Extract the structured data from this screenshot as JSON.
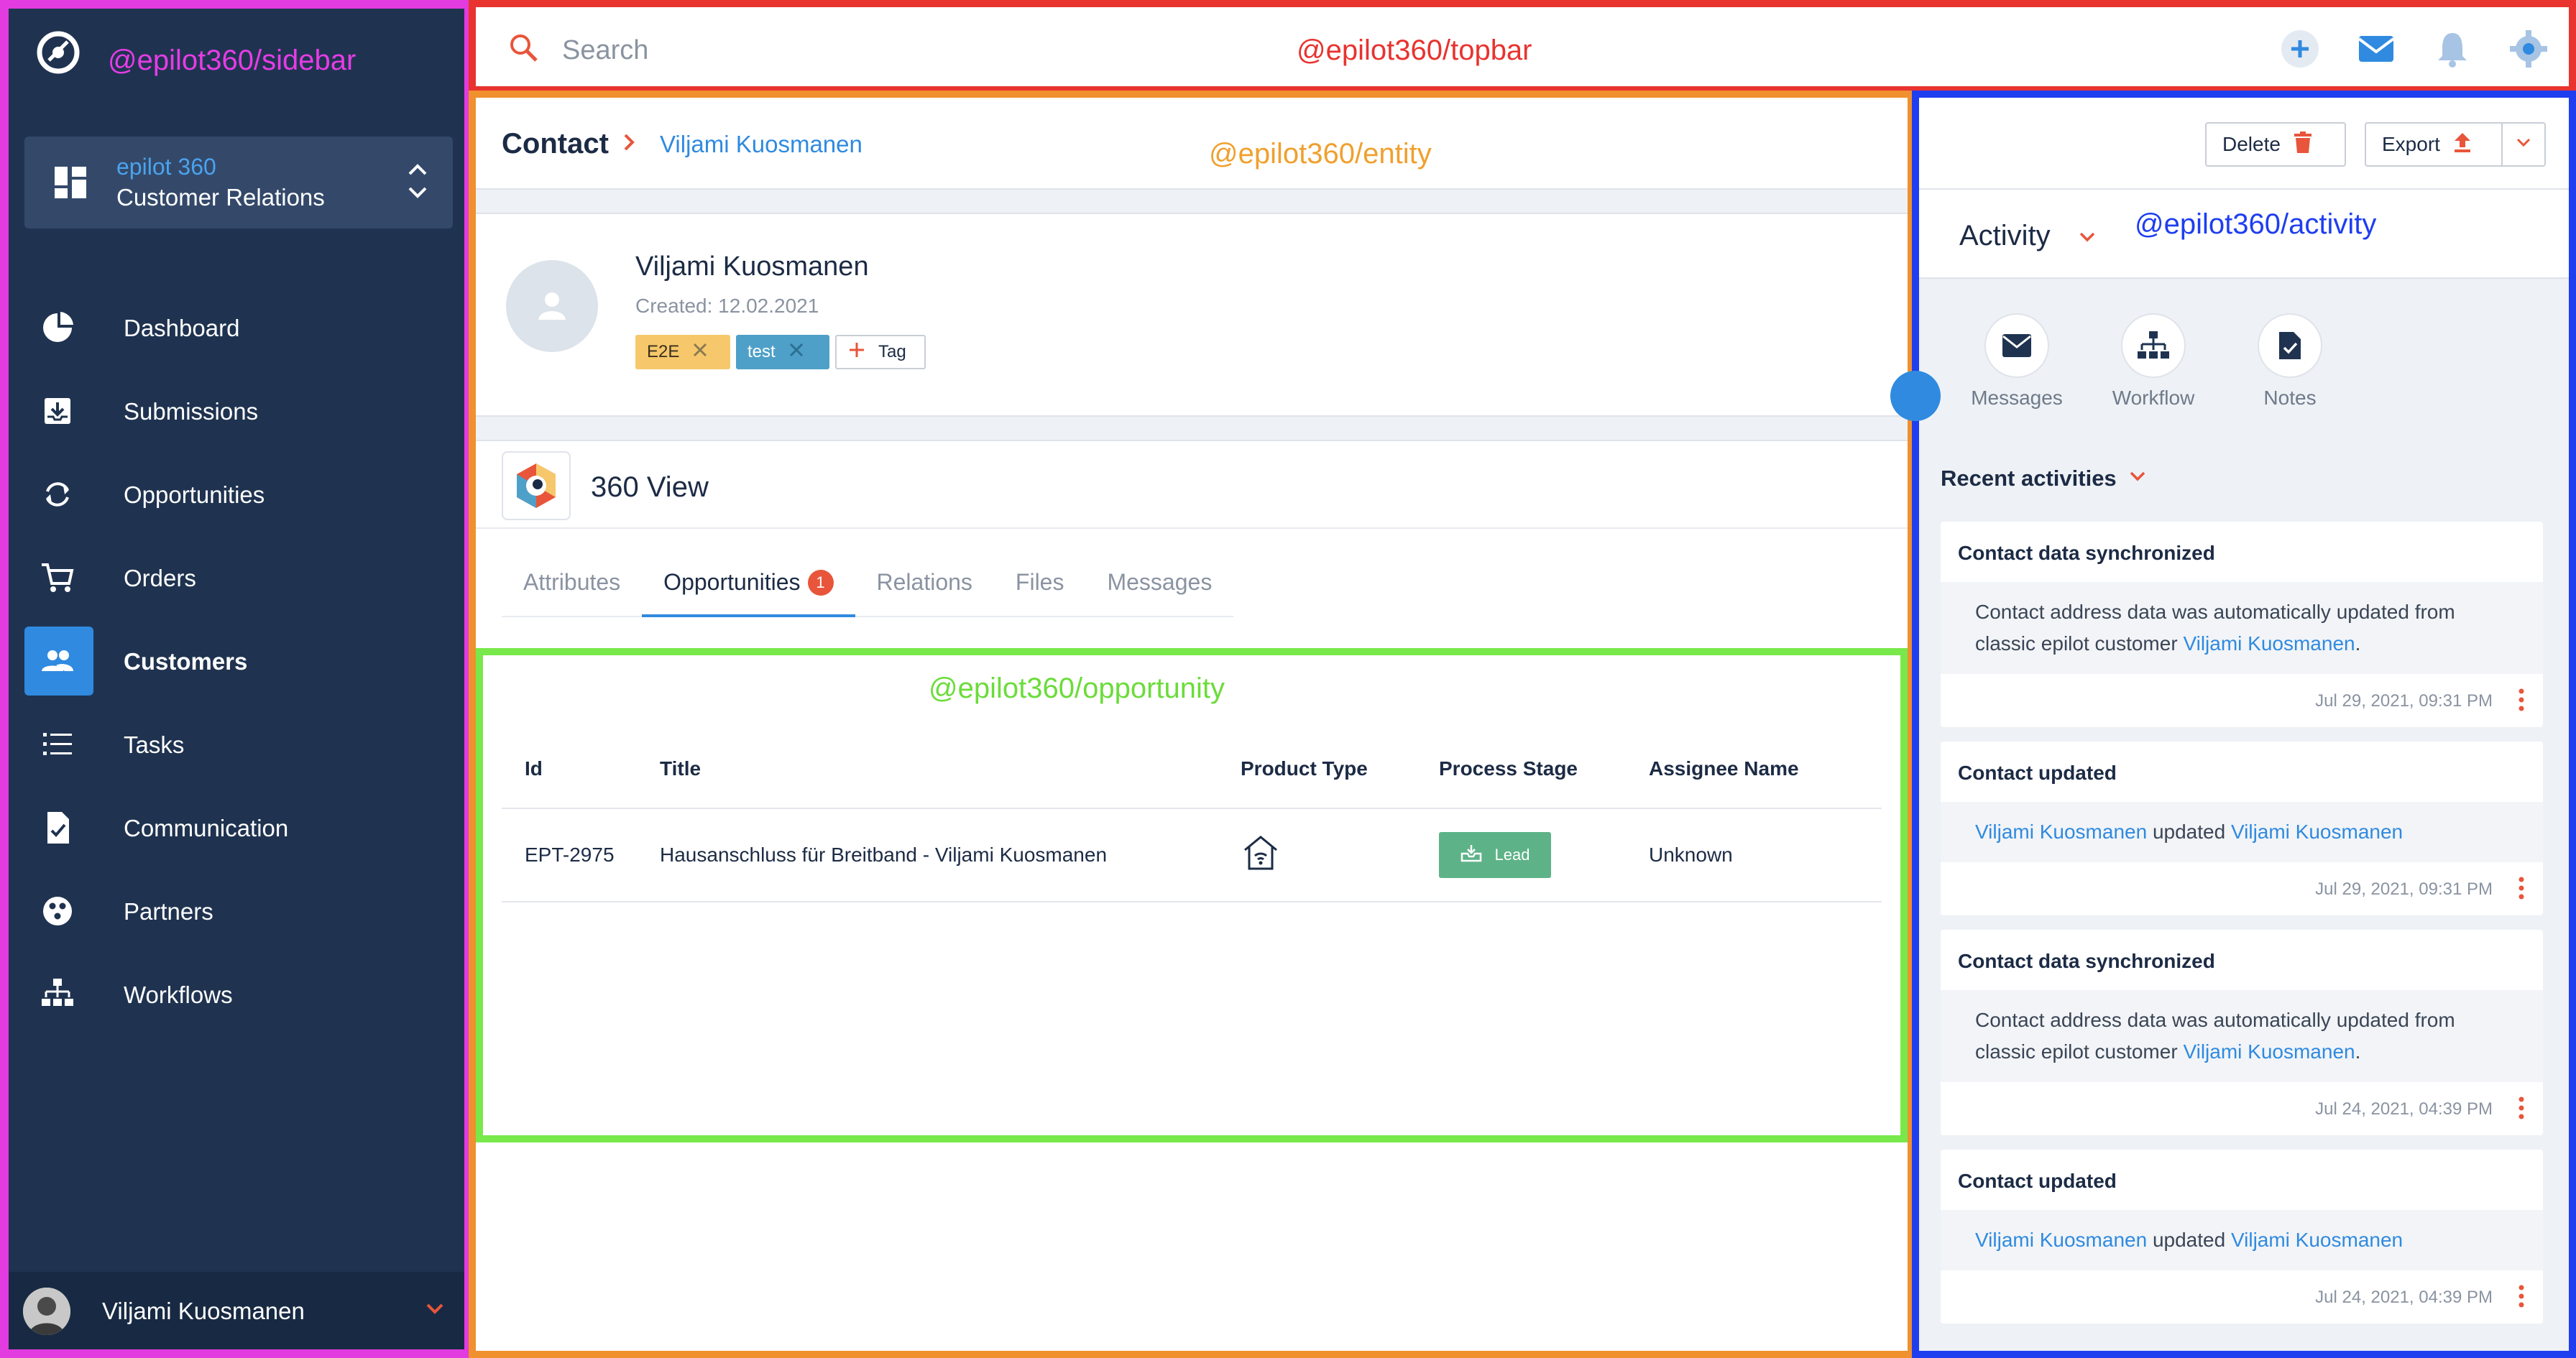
{
  "sidebar": {
    "mfe_label": "@epilot360/sidebar",
    "switcher": {
      "line1": "epilot 360",
      "line2": "Customer Relations"
    },
    "items": [
      {
        "label": "Dashboard"
      },
      {
        "label": "Submissions"
      },
      {
        "label": "Opportunities"
      },
      {
        "label": "Orders"
      },
      {
        "label": "Customers",
        "active": true
      },
      {
        "label": "Tasks"
      },
      {
        "label": "Communication"
      },
      {
        "label": "Partners"
      },
      {
        "label": "Workflows"
      }
    ],
    "user_name": "Viljami Kuosmanen"
  },
  "topbar": {
    "search_placeholder": "Search",
    "mfe_label": "@epilot360/topbar"
  },
  "entity": {
    "breadcrumb_root": "Contact",
    "breadcrumb_current": "Viljami Kuosmanen",
    "mfe_label": "@epilot360/entity",
    "name": "Viljami Kuosmanen",
    "created": "Created: 12.02.2021",
    "tags": [
      "E2E",
      "test"
    ],
    "add_tag_label": "Tag",
    "view_title": "360 View",
    "tabs": [
      {
        "label": "Attributes"
      },
      {
        "label": "Opportunities",
        "badge": "1",
        "active": true
      },
      {
        "label": "Relations"
      },
      {
        "label": "Files"
      },
      {
        "label": "Messages"
      }
    ]
  },
  "opportunity": {
    "mfe_label": "@epilot360/opportunity",
    "columns": [
      "Id",
      "Title",
      "Product Type",
      "Process Stage",
      "Assignee Name"
    ],
    "rows": [
      {
        "id": "EPT-2975",
        "title": "Hausanschluss für Breitband - Viljami Kuosmanen",
        "product_type_icon": "home-wifi-icon",
        "stage": "Lead",
        "assignee": "Unknown"
      }
    ]
  },
  "activity": {
    "delete_label": "Delete",
    "export_label": "Export",
    "title": "Activity",
    "mfe_label": "@epilot360/activity",
    "quick_actions": [
      {
        "label": "Messages",
        "icon": "mail-icon"
      },
      {
        "label": "Workflow",
        "icon": "workflow-icon"
      },
      {
        "label": "Notes",
        "icon": "note-icon"
      }
    ],
    "recent_label": "Recent activities",
    "items": [
      {
        "title": "Contact data synchronized",
        "text_before": "Contact address data was automatically updated from classic epilot customer ",
        "link": "Viljami Kuosmanen",
        "text_after": ".",
        "time": "Jul 29, 2021, 09:31 PM"
      },
      {
        "title": "Contact updated",
        "link1": "Viljami Kuosmanen",
        "middle": " updated ",
        "link2": "Viljami Kuosmanen",
        "time": "Jul 29, 2021, 09:31 PM"
      },
      {
        "title": "Contact data synchronized",
        "text_before": "Contact address data was automatically updated from classic epilot customer ",
        "link": "Viljami Kuosmanen",
        "text_after": ".",
        "time": "Jul 24, 2021, 04:39 PM"
      },
      {
        "title": "Contact updated",
        "link1": "Viljami Kuosmanen",
        "middle": " updated ",
        "link2": "Viljami Kuosmanen",
        "time": "Jul 24, 2021, 04:39 PM"
      }
    ]
  },
  "colors": {
    "sidebar_bg": "#1f3350",
    "accent_blue": "#2f8ae0",
    "accent_orange": "#e8553a",
    "stage_green": "#5db387"
  }
}
